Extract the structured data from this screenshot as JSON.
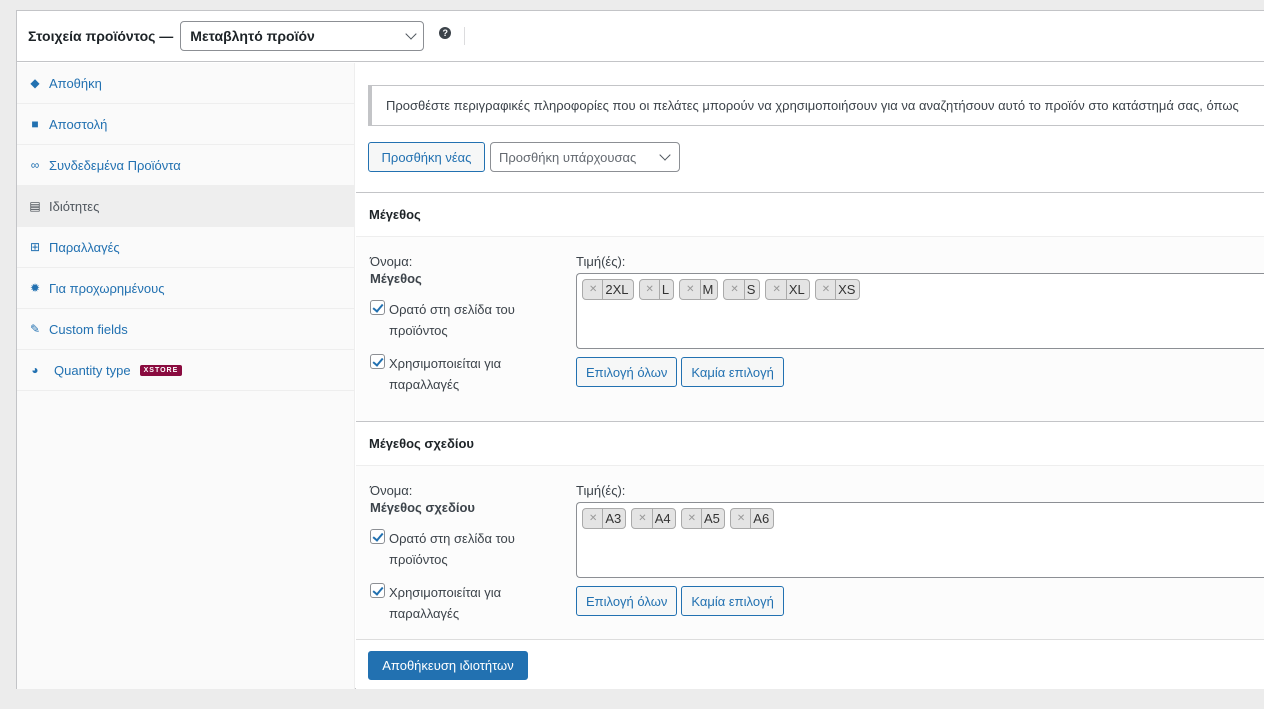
{
  "header": {
    "title": "Στοιχεία προϊόντος —",
    "product_type": "Μεταβλητό προϊόν",
    "help_icon": "question-circle-icon"
  },
  "sidebar": {
    "items": [
      {
        "label": "Αποθήκη",
        "icon": "tag-icon",
        "glyph": "◆",
        "active": false
      },
      {
        "label": "Αποστολή",
        "icon": "truck-icon",
        "glyph": "■",
        "active": false
      },
      {
        "label": "Συνδεδεμένα Προϊόντα",
        "icon": "link-icon",
        "glyph": "∞",
        "active": false
      },
      {
        "label": "Ιδιότητες",
        "icon": "list-icon",
        "glyph": "▤",
        "active": true
      },
      {
        "label": "Παραλλαγές",
        "icon": "grid-icon",
        "glyph": "⊞",
        "active": false
      },
      {
        "label": "Για προχωρημένους",
        "icon": "gear-icon",
        "glyph": "✹",
        "active": false
      },
      {
        "label": "Custom fields",
        "icon": "wrench-icon",
        "glyph": "✎",
        "active": false
      },
      {
        "label": "Quantity type",
        "icon": "pie-chart-icon",
        "glyph": "◕",
        "active": false,
        "badge": "XSTORE"
      }
    ]
  },
  "main": {
    "notice": "Προσθέστε περιγραφικές πληροφορίες που οι πελάτες μπορούν να χρησιμοποιήσουν για να αναζητήσουν αυτό το προϊόν στο κατάστημά σας, όπως",
    "add_new_label": "Προσθήκη νέας",
    "add_existing_placeholder": "Προσθήκη υπάρχουσας",
    "attributes": [
      {
        "title": "Μέγεθος",
        "name_label": "Όνομα:",
        "name_value": "Μέγεθος",
        "values_label": "Τιμή(ές):",
        "values": [
          "2XL",
          "L",
          "M",
          "S",
          "XL",
          "XS"
        ],
        "visible_label": "Ορατό στη σελίδα του προϊόντος",
        "visible_checked": true,
        "variations_label": "Χρησιμοποιείται για παραλλαγές",
        "variations_checked": true,
        "select_all_label": "Επιλογή όλων",
        "select_none_label": "Καμία επιλογή"
      },
      {
        "title": "Μέγεθος σχεδίου",
        "name_label": "Όνομα:",
        "name_value": "Μέγεθος σχεδίου",
        "values_label": "Τιμή(ές):",
        "values": [
          "A3",
          "A4",
          "A5",
          "A6"
        ],
        "visible_label": "Ορατό στη σελίδα του προϊόντος",
        "visible_checked": true,
        "variations_label": "Χρησιμοποιείται για παραλλαγές",
        "variations_checked": true,
        "select_all_label": "Επιλογή όλων",
        "select_none_label": "Καμία επιλογή"
      }
    ],
    "save_label": "Αποθήκευση ιδιοτήτων"
  }
}
